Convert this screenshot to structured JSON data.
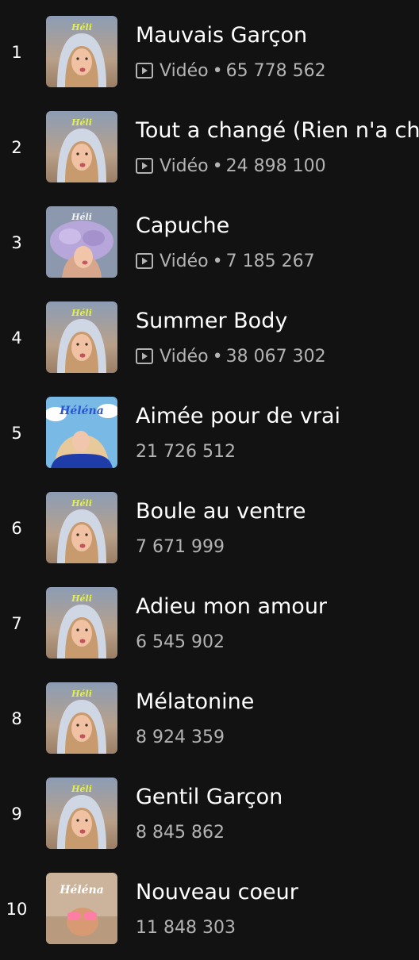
{
  "colors": {
    "background": "#121212",
    "text_primary": "#ffffff",
    "text_secondary": "#b3b3b3",
    "cover_title_yellow": "#e6f04a",
    "cover_title_blue": "#2b56d0"
  },
  "icons": {
    "video": "play-in-square-icon"
  },
  "tracks": [
    {
      "index": "1",
      "title": "Mauvais Garçon",
      "is_video": true,
      "type_label": "Vidéo",
      "separator": "•",
      "plays": "65 778 562",
      "cover": {
        "logo_text": "Héli"
      }
    },
    {
      "index": "2",
      "title": "Tout a changé (Rien n'a cha",
      "is_video": true,
      "type_label": "Vidéo",
      "separator": "•",
      "plays": "24 898 100",
      "cover": {
        "logo_text": "Héli"
      }
    },
    {
      "index": "3",
      "title": "Capuche",
      "is_video": true,
      "type_label": "Vidéo",
      "separator": "•",
      "plays": "7 185 267",
      "cover": {
        "logo_text": "Héli"
      }
    },
    {
      "index": "4",
      "title": "Summer Body",
      "is_video": true,
      "type_label": "Vidéo",
      "separator": "•",
      "plays": "38 067 302",
      "cover": {
        "logo_text": "Héli"
      }
    },
    {
      "index": "5",
      "title": "Aimée pour de vrai",
      "is_video": false,
      "type_label": "",
      "separator": "",
      "plays": "21 726 512",
      "cover": {
        "logo_text": "Héléna"
      }
    },
    {
      "index": "6",
      "title": "Boule au ventre",
      "is_video": false,
      "type_label": "",
      "separator": "",
      "plays": "7 671 999",
      "cover": {
        "logo_text": "Héli"
      }
    },
    {
      "index": "7",
      "title": "Adieu mon amour",
      "is_video": false,
      "type_label": "",
      "separator": "",
      "plays": "6 545 902",
      "cover": {
        "logo_text": "Héli"
      }
    },
    {
      "index": "8",
      "title": "Mélatonine",
      "is_video": false,
      "type_label": "",
      "separator": "",
      "plays": "8 924 359",
      "cover": {
        "logo_text": "Héli"
      }
    },
    {
      "index": "9",
      "title": "Gentil Garçon",
      "is_video": false,
      "type_label": "",
      "separator": "",
      "plays": "8 845 862",
      "cover": {
        "logo_text": "Héli"
      }
    },
    {
      "index": "10",
      "title": "Nouveau coeur",
      "is_video": false,
      "type_label": "",
      "separator": "",
      "plays": "11 848 303",
      "cover": {
        "logo_text": "Héléna"
      }
    }
  ]
}
